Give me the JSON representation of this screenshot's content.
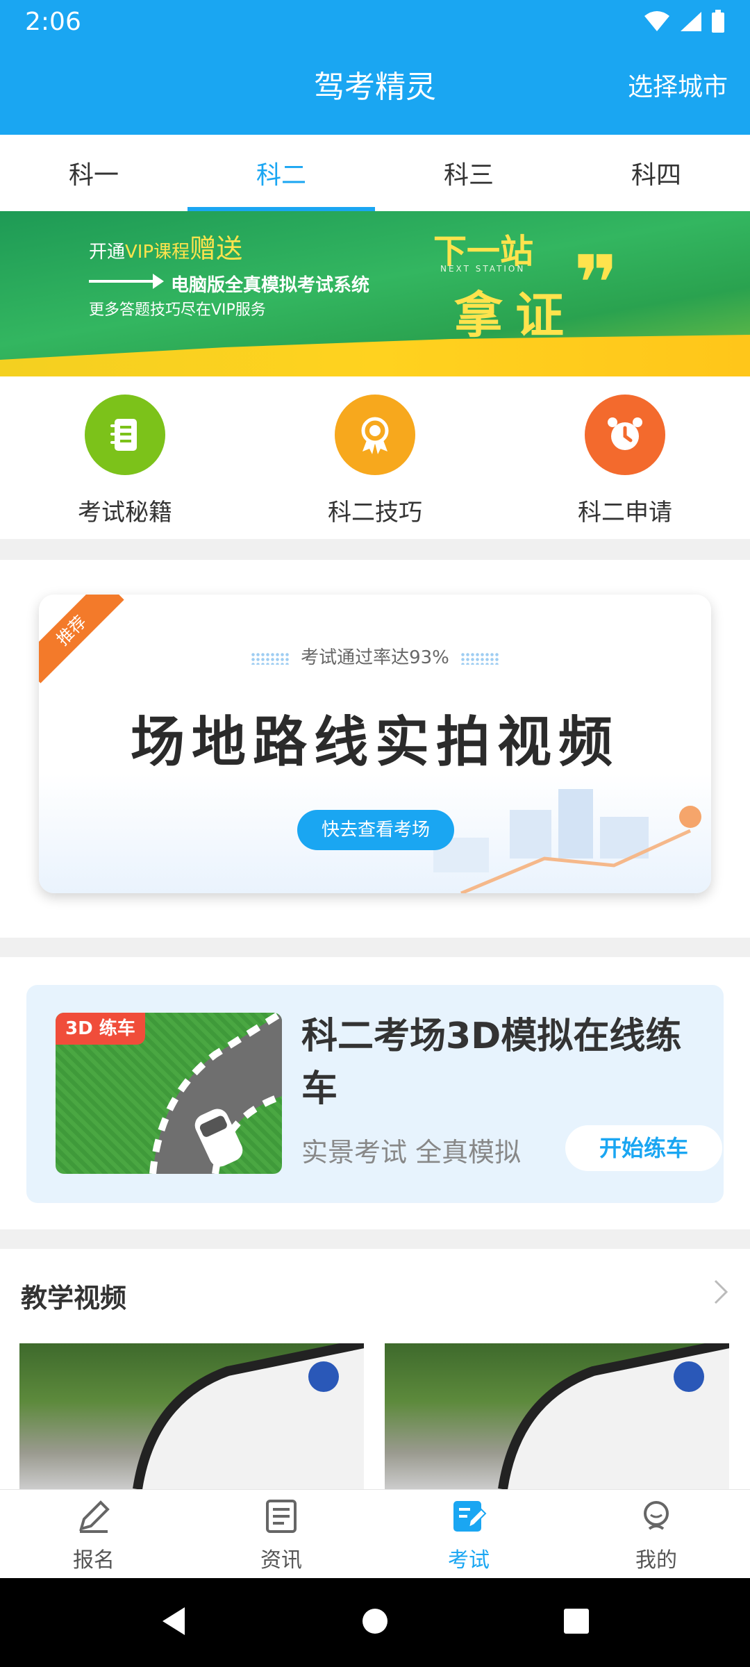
{
  "status_bar": {
    "time": "2:06"
  },
  "header": {
    "title": "驾考精灵",
    "city_button": "选择城市"
  },
  "tabs": [
    {
      "label": "科一",
      "active": false
    },
    {
      "label": "科二",
      "active": true
    },
    {
      "label": "科三",
      "active": false
    },
    {
      "label": "科四",
      "active": false
    }
  ],
  "vip_banner": {
    "line1_prefix": "开通",
    "line1_vip": "VIP课程",
    "line1_gift": "赠送",
    "line2": "电脑版全真模拟考试系统",
    "line3": "更多答题技巧尽在VIP服务",
    "next_stop": "下一站",
    "next_stop_en": "NEXT STATION",
    "license": "拿证"
  },
  "quick_entries": [
    {
      "label": "考试秘籍",
      "icon": "notebook-icon",
      "color": "#7cc21a"
    },
    {
      "label": "科二技巧",
      "icon": "award-icon",
      "color": "#f7a81d"
    },
    {
      "label": "科二申请",
      "icon": "alarm-clock-icon",
      "color": "#f36a2d"
    }
  ],
  "recommend_card": {
    "ribbon": "推荐",
    "subtitle": "考试通过率达93%",
    "title": "场地路线实拍视频",
    "button": "快去查看考场"
  },
  "practice_3d_card": {
    "badge": "3D 练车",
    "title": "科二考场3D模拟在线练车",
    "subtitle": "实景考试 全真模拟",
    "button": "开始练车"
  },
  "teaching_videos": {
    "title": "教学视频"
  },
  "bottom_nav": [
    {
      "label": "报名",
      "icon": "signup-pen-icon",
      "active": false
    },
    {
      "label": "资讯",
      "icon": "news-icon",
      "active": false
    },
    {
      "label": "考试",
      "icon": "exam-icon",
      "active": true
    },
    {
      "label": "我的",
      "icon": "profile-icon",
      "active": false
    }
  ],
  "colors": {
    "primary": "#1aa6f2",
    "orange": "#f37a2a",
    "red_badge": "#f04d3a"
  }
}
